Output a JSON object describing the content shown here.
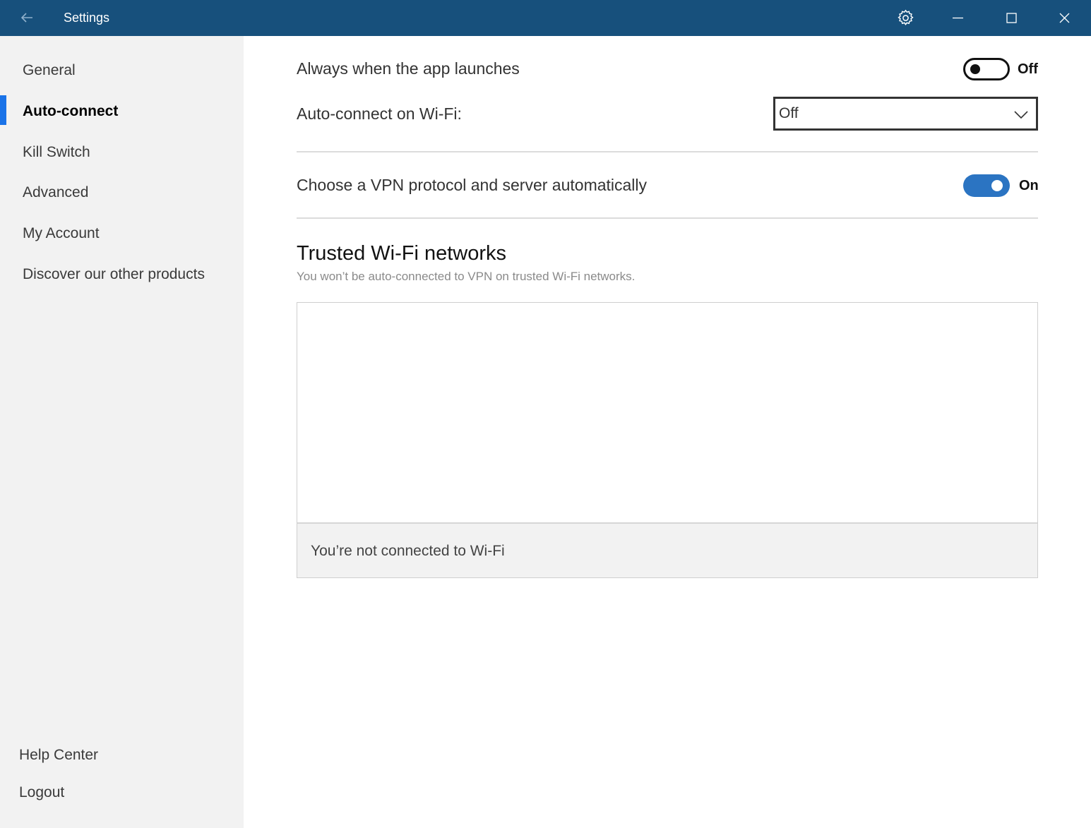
{
  "window": {
    "title": "Settings"
  },
  "sidebar": {
    "items": [
      {
        "label": "General",
        "active": false
      },
      {
        "label": "Auto-connect",
        "active": true
      },
      {
        "label": "Kill Switch",
        "active": false
      },
      {
        "label": "Advanced",
        "active": false
      },
      {
        "label": "My Account",
        "active": false
      },
      {
        "label": "Discover our other products",
        "active": false
      }
    ],
    "footer": [
      {
        "label": "Help Center"
      },
      {
        "label": "Logout"
      }
    ]
  },
  "main": {
    "launch_row": {
      "label": "Always when the app launches",
      "toggle_state": "Off"
    },
    "wifi_row": {
      "label": "Auto-connect on Wi-Fi:",
      "selected": "Off"
    },
    "protocol_row": {
      "label": "Choose a VPN protocol and server automatically",
      "toggle_state": "On"
    },
    "trusted": {
      "title": "Trusted Wi-Fi networks",
      "subtitle": "You won’t be auto-connected to VPN on trusted Wi-Fi networks.",
      "footer_message": "You’re not connected to Wi-Fi"
    }
  },
  "colors": {
    "titlebar": "#17507c",
    "accent": "#2b74c2",
    "nav_indicator": "#1a73e8"
  },
  "icons": [
    "back-arrow-icon",
    "gear-icon",
    "minimize-icon",
    "maximize-icon",
    "close-icon",
    "chevron-down-icon"
  ]
}
